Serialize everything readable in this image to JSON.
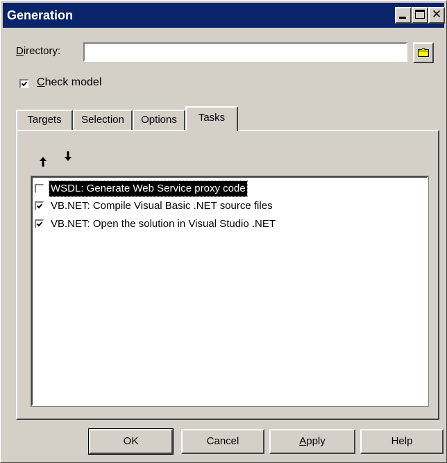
{
  "window": {
    "title": "Generation",
    "controls": {
      "minimize_icon": "minimize-icon",
      "maximize_icon": "maximize-icon",
      "close_icon": "close-icon",
      "close_glyph": "✕"
    }
  },
  "directory": {
    "label_prefix": "D",
    "label_rest": "irectory:",
    "value": "",
    "placeholder": "",
    "browse_icon": "folder-icon"
  },
  "check_model": {
    "label_prefix": "C",
    "label_rest": "heck model",
    "checked": true
  },
  "tabs": [
    {
      "label": "Targets",
      "active": false
    },
    {
      "label": "Selection",
      "active": false
    },
    {
      "label": "Options",
      "active": false
    },
    {
      "label": "Tasks",
      "active": true
    }
  ],
  "tasks_panel": {
    "move_up_icon": "arrow-up-icon",
    "move_down_icon": "arrow-down-icon",
    "items": [
      {
        "label": "WSDL: Generate Web Service proxy code",
        "checked": false,
        "selected": true
      },
      {
        "label": "VB.NET: Compile Visual Basic .NET source files",
        "checked": true,
        "selected": false
      },
      {
        "label": "VB.NET: Open the solution in Visual Studio .NET",
        "checked": true,
        "selected": false
      }
    ]
  },
  "buttons": {
    "ok": "OK",
    "cancel": "Cancel",
    "apply_prefix": "A",
    "apply_rest": "pply",
    "help": "Help"
  },
  "colors": {
    "titlebar": "#0a246a",
    "face": "#d4d0c8",
    "selection": "#000000",
    "folder": "#ffff00"
  }
}
